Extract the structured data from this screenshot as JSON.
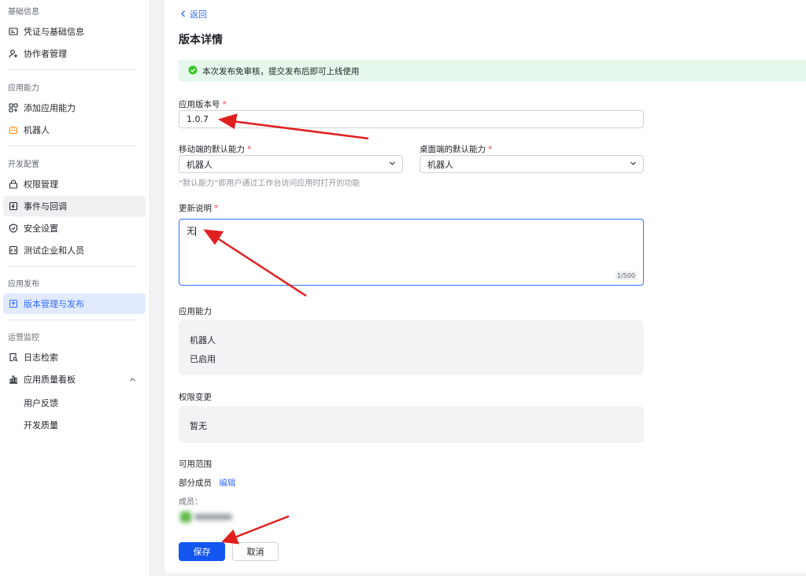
{
  "sidebar": {
    "sections": [
      {
        "title": "基础信息",
        "items": [
          {
            "label": "凭证与基础信息",
            "icon": "id-card-icon"
          },
          {
            "label": "协作者管理",
            "icon": "user-add-icon"
          }
        ]
      },
      {
        "title": "应用能力",
        "items": [
          {
            "label": "添加应用能力",
            "icon": "grid-add-icon"
          },
          {
            "label": "机器人",
            "icon": "robot-icon"
          }
        ]
      },
      {
        "title": "开发配置",
        "items": [
          {
            "label": "权限管理",
            "icon": "lock-icon"
          },
          {
            "label": "事件与回调",
            "icon": "event-icon"
          },
          {
            "label": "安全设置",
            "icon": "shield-icon"
          },
          {
            "label": "测试企业和人员",
            "icon": "code-icon"
          }
        ]
      },
      {
        "title": "应用发布",
        "items": [
          {
            "label": "版本管理与发布",
            "icon": "upload-icon"
          }
        ]
      },
      {
        "title": "运营监控",
        "items": [
          {
            "label": "日志检索",
            "icon": "search-doc-icon"
          },
          {
            "label": "应用质量看板",
            "icon": "bar-chart-icon"
          }
        ],
        "subitems": [
          "用户反馈",
          "开发质量"
        ]
      }
    ]
  },
  "main": {
    "back_label": "返回",
    "title": "版本详情",
    "notice": "本次发布免审核，提交发布后即可上线使用",
    "version": {
      "label": "应用版本号",
      "value": "1.0.7"
    },
    "mobile_default": {
      "label": "移动端的默认能力",
      "value": "机器人"
    },
    "desktop_default": {
      "label": "桌面端的默认能力",
      "value": "机器人"
    },
    "default_hint": "“默认能力”即用户通过工作台访问应用时打开的功能",
    "release_notes": {
      "label": "更新说明",
      "value": "无",
      "counter": "1/500"
    },
    "capabilities": {
      "label": "应用能力",
      "name": "机器人",
      "status": "已启用"
    },
    "permission_changes": {
      "label": "权限变更",
      "value": "暂无"
    },
    "scope": {
      "label": "可用范围",
      "value": "部分成员",
      "edit": "编辑",
      "members_label": "成员："
    },
    "save_label": "保存",
    "cancel_label": "取消"
  },
  "colors": {
    "accent": "#3370ff",
    "primary_button": "#1456f0",
    "success": "#34c724",
    "required": "#f54a45",
    "annotation_arrow": "#e02020"
  }
}
